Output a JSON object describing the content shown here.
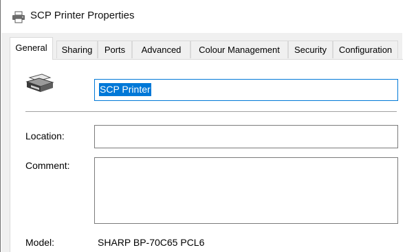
{
  "window": {
    "title": "SCP Printer Properties"
  },
  "tabs": [
    {
      "label": "General",
      "active": true
    },
    {
      "label": "Sharing"
    },
    {
      "label": "Ports"
    },
    {
      "label": "Advanced"
    },
    {
      "label": "Colour Management"
    },
    {
      "label": "Security"
    },
    {
      "label": "Configuration"
    }
  ],
  "general": {
    "printer_name": "SCP Printer",
    "location_label": "Location:",
    "location_value": "",
    "comment_label": "Comment:",
    "comment_value": "",
    "model_label": "Model:",
    "model_value": "SHARP BP-70C65 PCL6"
  },
  "icons": {
    "title": "printer-icon",
    "device": "printer-icon"
  },
  "colors": {
    "selection": "#0078d7",
    "focus_border": "#0078d7",
    "dialog_bg": "#f0f0f0"
  }
}
